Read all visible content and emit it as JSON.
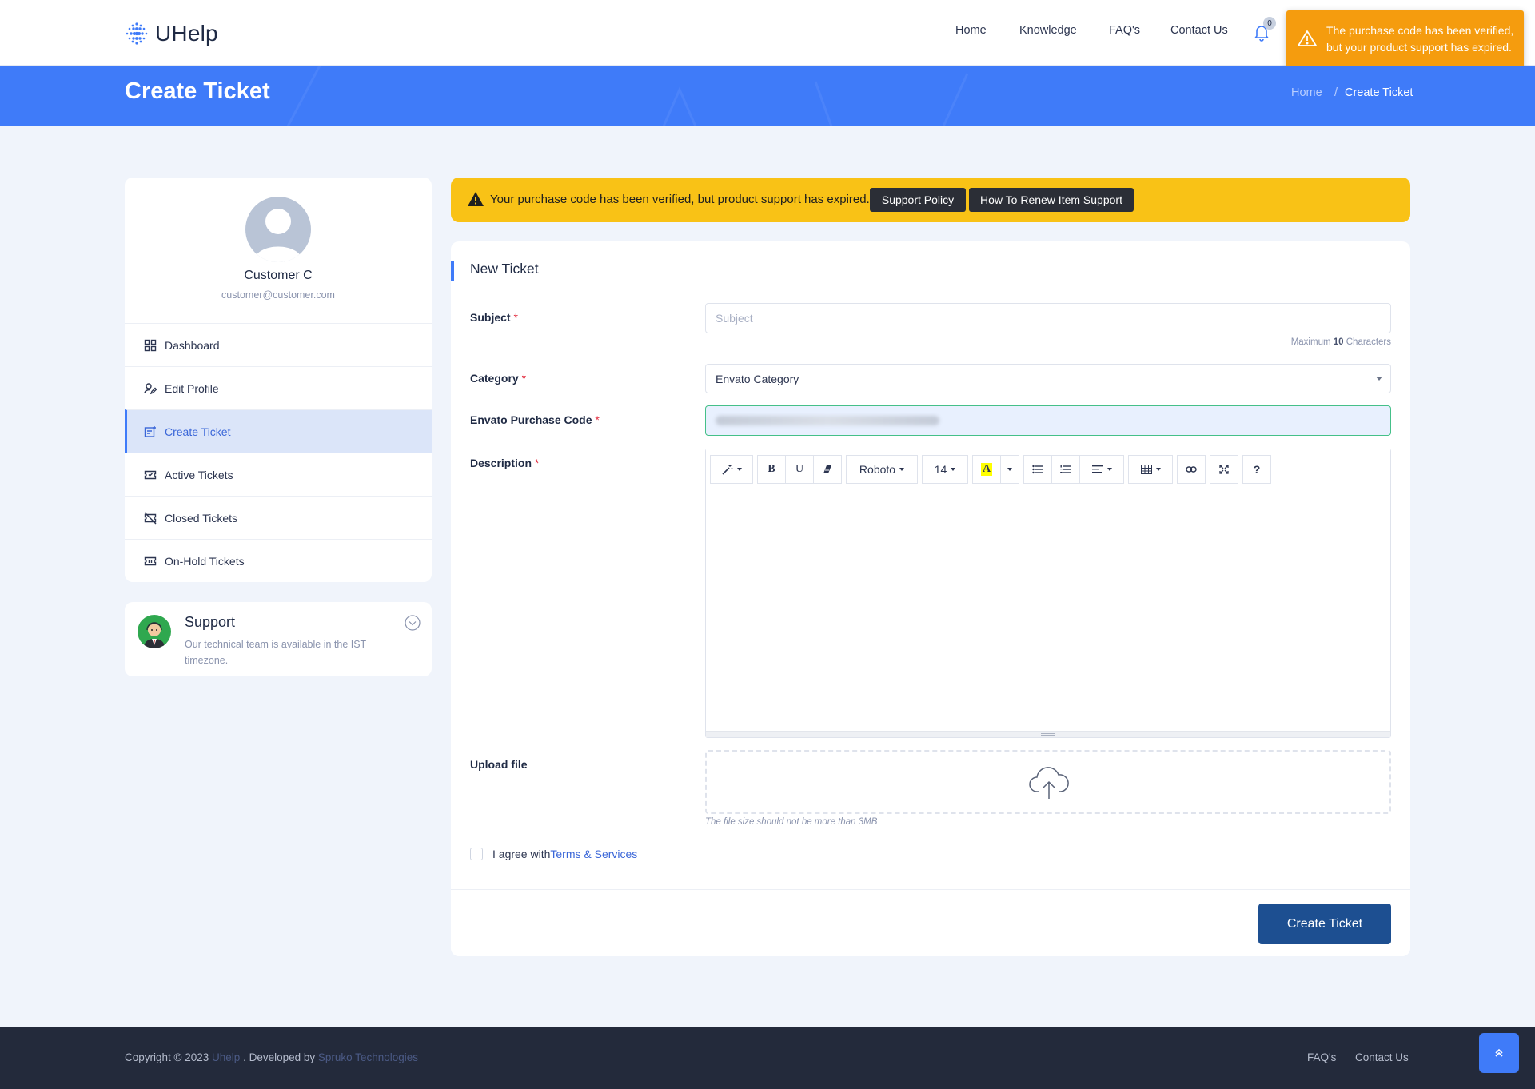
{
  "brand": {
    "name": "UHelp"
  },
  "nav": {
    "items": [
      "Home",
      "Knowledge",
      "FAQ's",
      "Contact Us"
    ],
    "notifications_count": "0"
  },
  "toast": {
    "message": "The purchase code has been verified, but your product support has expired.",
    "color": "#f59c0e"
  },
  "hero": {
    "title": "Create Ticket",
    "breadcrumb_home": "Home",
    "breadcrumb_sep": "/",
    "breadcrumb_current": "Create Ticket"
  },
  "profile": {
    "name": "Customer C",
    "email": "customer@customer.com"
  },
  "menu": [
    {
      "label": "Dashboard",
      "icon": "dashboard-icon"
    },
    {
      "label": "Edit Profile",
      "icon": "edit-profile-icon"
    },
    {
      "label": "Create Ticket",
      "icon": "create-ticket-icon",
      "active": true
    },
    {
      "label": "Active Tickets",
      "icon": "ticket-icon"
    },
    {
      "label": "Closed Tickets",
      "icon": "closed-ticket-icon"
    },
    {
      "label": "On-Hold Tickets",
      "icon": "onhold-ticket-icon"
    }
  ],
  "support": {
    "title": "Support",
    "text": "Our technical team is available in the IST timezone."
  },
  "alert": {
    "text": "Your purchase code has been verified, but product support has expired.",
    "btn_policy": "Support Policy",
    "btn_renew": "How To Renew Item Support",
    "color": "#f9c216"
  },
  "form": {
    "title": "New Ticket",
    "subject_label": "Subject",
    "subject_placeholder": "Subject",
    "subject_hint_prefix": "Maximum",
    "subject_hint_max": "10",
    "subject_hint_suffix": "Characters",
    "category_label": "Category",
    "category_value": "Envato Category",
    "code_label": "Envato Purchase Code",
    "description_label": "Description",
    "toolbar": {
      "font": "Roboto",
      "size": "14"
    },
    "upload_label": "Upload file",
    "upload_hint": "The file size should not be more than 3MB",
    "agree_text": "I agree with",
    "agree_link": "Terms & Services",
    "submit": "Create Ticket",
    "required_mark": "*"
  },
  "footer": {
    "copy_prefix": "Copyright © 2023",
    "brand_link": "Uhelp",
    "copy_mid": ". Developed by",
    "dev_link": "Spruko Technologies",
    "links": [
      "FAQ's",
      "Contact Us"
    ]
  },
  "colors": {
    "primary": "#3f7bf9",
    "submit": "#1d4f91",
    "footer": "#232a3b"
  }
}
